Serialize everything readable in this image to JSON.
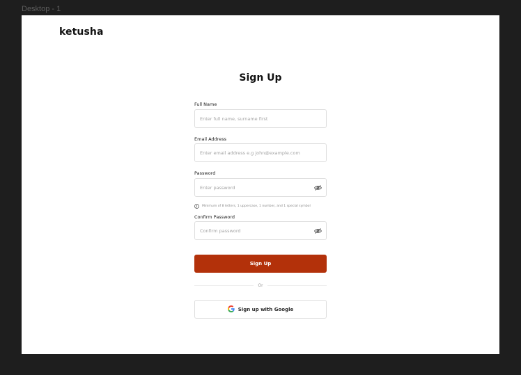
{
  "canvas": {
    "frame_label": "Desktop - 1"
  },
  "header": {
    "logo": "ketusha"
  },
  "page": {
    "title": "Sign Up"
  },
  "form": {
    "full_name": {
      "label": "Full Name",
      "placeholder": "Enter full name, surname first",
      "value": ""
    },
    "email": {
      "label": "Email Address",
      "placeholder": "Enter email address e.g john@example.com",
      "value": ""
    },
    "password": {
      "label": "Password",
      "placeholder": "Enter password",
      "value": "",
      "hint": "Minimum of 8 letters, 1 uppercase, 1 number, and 1 special symbol"
    },
    "confirm_password": {
      "label": "Confirm Password",
      "placeholder": "Confirm password",
      "value": ""
    },
    "submit_label": "Sign Up",
    "divider_text": "Or",
    "google_label": "Sign up with Google"
  },
  "icons": {
    "password_toggle": "eye-off-icon",
    "hint": "info-icon",
    "google": "google-logo-icon"
  },
  "colors": {
    "primary": "#b3310a",
    "background": "#1e1e1e",
    "frame": "#ffffff"
  }
}
